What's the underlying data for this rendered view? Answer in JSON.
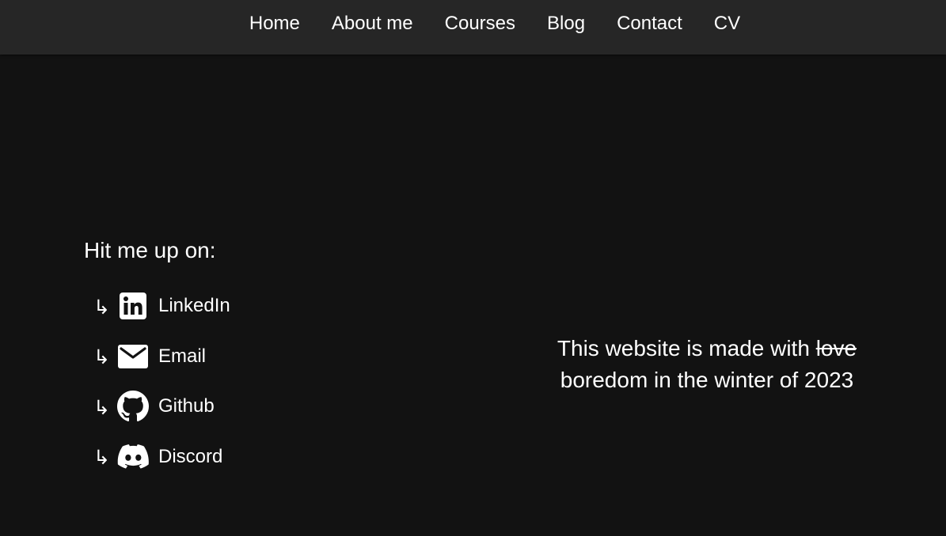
{
  "nav": {
    "items": [
      {
        "label": "Home"
      },
      {
        "label": "About me"
      },
      {
        "label": "Courses"
      },
      {
        "label": "Blog"
      },
      {
        "label": "Contact"
      },
      {
        "label": "CV"
      }
    ]
  },
  "contact": {
    "heading": "Hit me up on:",
    "arrow": "↳",
    "links": [
      {
        "label": "LinkedIn",
        "icon": "linkedin-icon"
      },
      {
        "label": "Email",
        "icon": "email-icon"
      },
      {
        "label": "Github",
        "icon": "github-icon"
      },
      {
        "label": "Discord",
        "icon": "discord-icon"
      }
    ]
  },
  "footer": {
    "prefix": "This website is made with ",
    "struck": "love",
    "suffix": "boredom in the winter of 2023"
  },
  "colors": {
    "background": "#121212",
    "navbar": "#262626",
    "text": "#ffffff"
  }
}
